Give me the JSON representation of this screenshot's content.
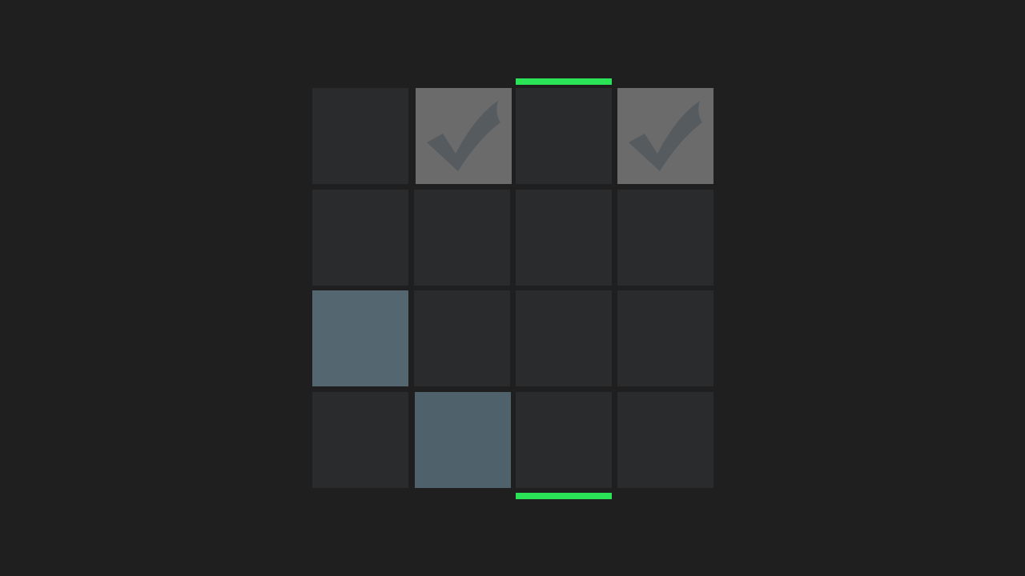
{
  "board": {
    "rows": 4,
    "cols": 4,
    "selected_column": 3,
    "colors": {
      "background": "#1f1f1f",
      "empty": "#2a2b2d",
      "checked": "#6b6b6b",
      "check_mark": "#565b60",
      "filled_a": "#546670",
      "filled_b": "#4f616b",
      "marker": "#2be356"
    },
    "cells": [
      {
        "row": 1,
        "col": 1,
        "state": "empty"
      },
      {
        "row": 1,
        "col": 2,
        "state": "checked",
        "icon": "checkmark-icon"
      },
      {
        "row": 1,
        "col": 3,
        "state": "empty"
      },
      {
        "row": 1,
        "col": 4,
        "state": "checked",
        "icon": "checkmark-icon"
      },
      {
        "row": 2,
        "col": 1,
        "state": "empty"
      },
      {
        "row": 2,
        "col": 2,
        "state": "empty"
      },
      {
        "row": 2,
        "col": 3,
        "state": "empty"
      },
      {
        "row": 2,
        "col": 4,
        "state": "empty"
      },
      {
        "row": 3,
        "col": 1,
        "state": "filled"
      },
      {
        "row": 3,
        "col": 2,
        "state": "empty"
      },
      {
        "row": 3,
        "col": 3,
        "state": "empty"
      },
      {
        "row": 3,
        "col": 4,
        "state": "empty"
      },
      {
        "row": 4,
        "col": 1,
        "state": "empty"
      },
      {
        "row": 4,
        "col": 2,
        "state": "filled"
      },
      {
        "row": 4,
        "col": 3,
        "state": "empty"
      },
      {
        "row": 4,
        "col": 4,
        "state": "empty"
      }
    ]
  }
}
